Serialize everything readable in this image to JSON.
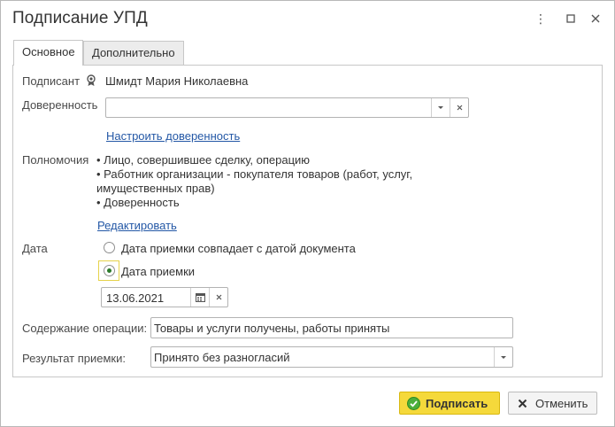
{
  "window": {
    "title": "Подписание УПД",
    "more_glyph": "⋮",
    "maximize_glyph": "☐",
    "close_glyph": "✕"
  },
  "tabs": [
    {
      "label": "Основное",
      "active": true
    },
    {
      "label": "Дополнительно",
      "active": false
    }
  ],
  "signer": {
    "label": "Подписант",
    "icon": "certificate-icon",
    "value": "Шмидт Мария Николаевна"
  },
  "power_of_attorney": {
    "label": "Доверенность",
    "value": "",
    "configure_link": "Настроить доверенность"
  },
  "authority": {
    "label": "Полномочия",
    "lines": [
      "• Лицо, совершившее сделку, операцию",
      "• Работник организации - покупателя товаров (работ, услуг,",
      "имущественных прав)",
      "• Доверенность"
    ],
    "edit_link": "Редактировать"
  },
  "date": {
    "label": "Дата",
    "options": [
      {
        "label": "Дата приемки совпадает с датой документа",
        "selected": false
      },
      {
        "label": "Дата приемки",
        "selected": true
      }
    ],
    "value": "13.06.2021"
  },
  "operation": {
    "label": "Содержание операции:",
    "value": "Товары и услуги получены, работы приняты"
  },
  "result": {
    "label": "Результат приемки:",
    "value": "Принято без разногласий"
  },
  "footer": {
    "sign_label": "Подписать",
    "cancel_label": "Отменить"
  },
  "colors": {
    "primary_button": "#f5d93b",
    "link": "#2458a6",
    "radio_selected": "#2a7a2a"
  }
}
